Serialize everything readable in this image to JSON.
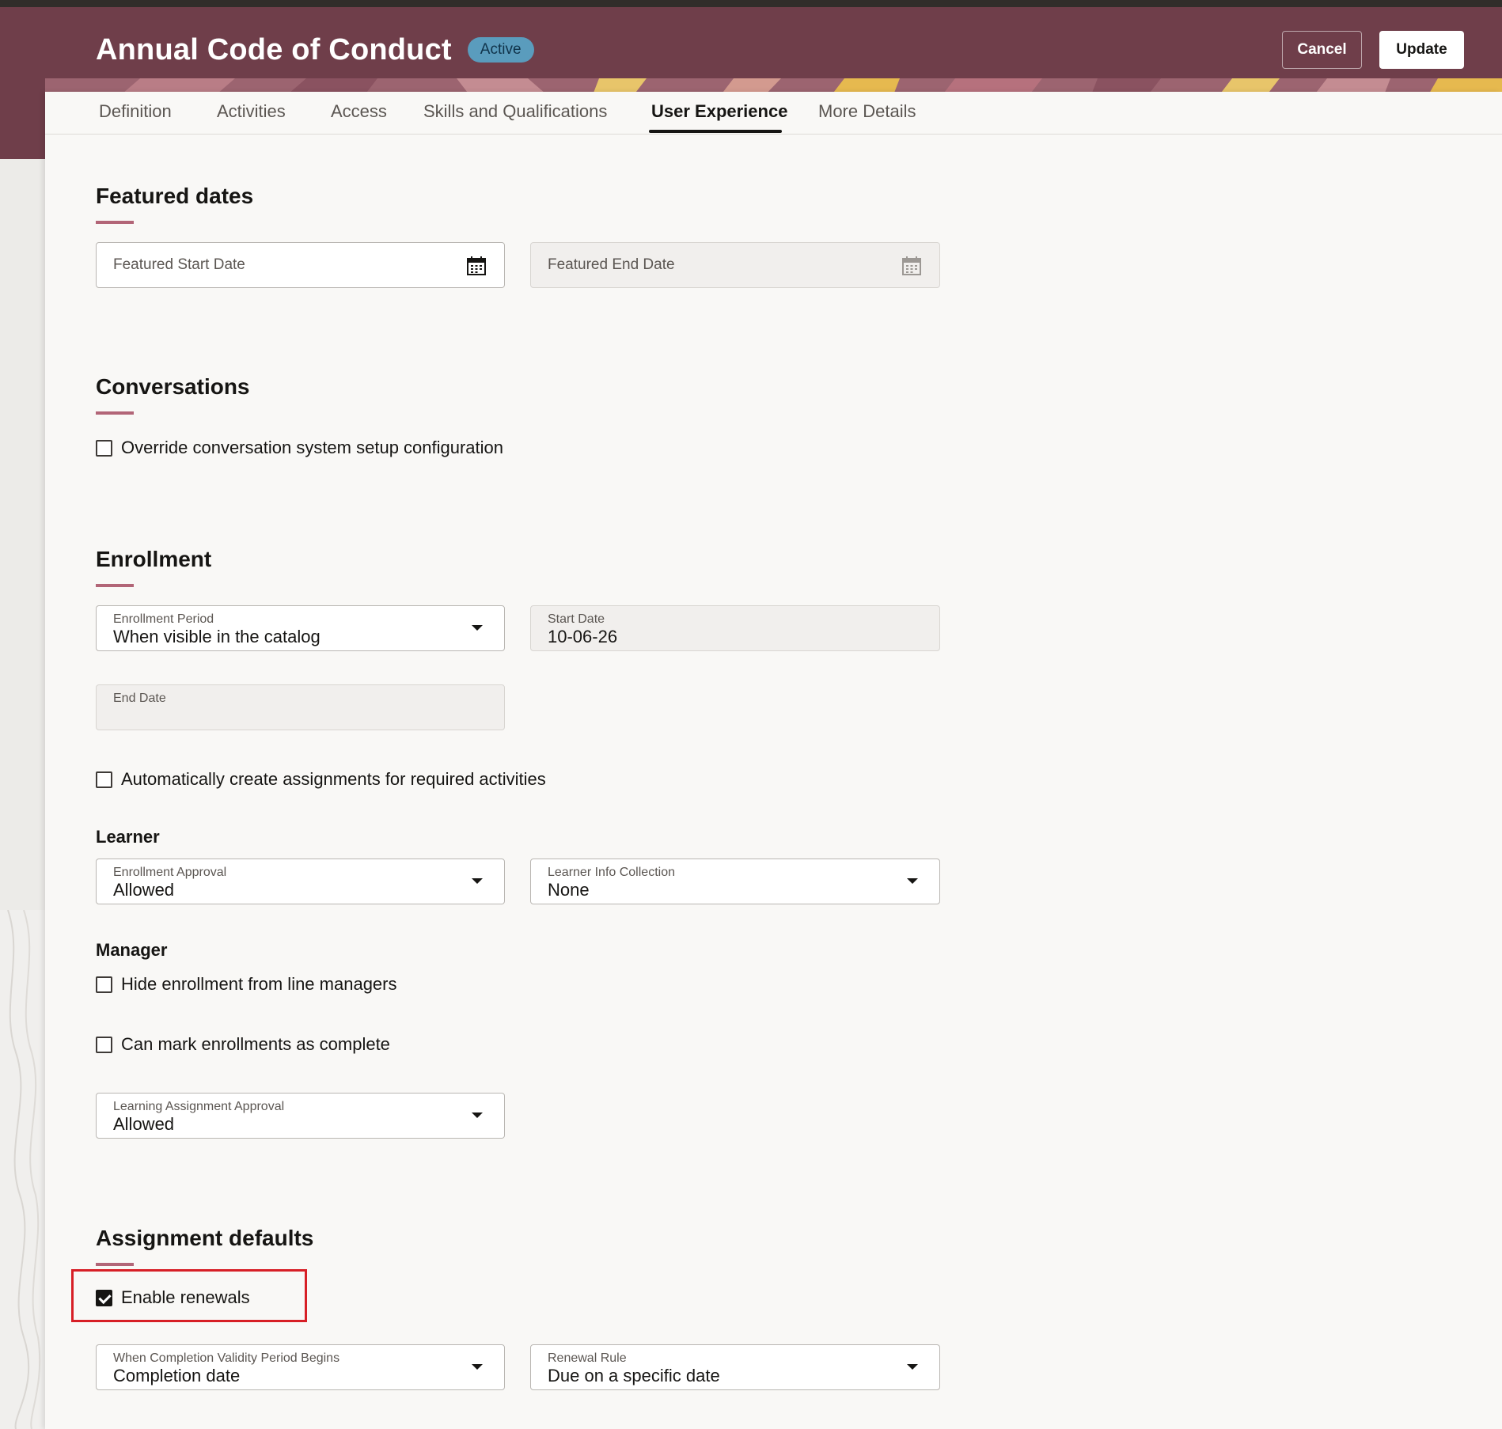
{
  "header": {
    "title": "Annual Code of Conduct",
    "status": "Active",
    "cancel_label": "Cancel",
    "update_label": "Update"
  },
  "tabs": [
    {
      "label": "Definition"
    },
    {
      "label": "Activities"
    },
    {
      "label": "Access"
    },
    {
      "label": "Skills and Qualifications"
    },
    {
      "label": "User Experience",
      "active": true
    },
    {
      "label": "More Details"
    }
  ],
  "featured_dates": {
    "title": "Featured dates",
    "start_placeholder": "Featured Start Date",
    "end_placeholder": "Featured End Date"
  },
  "conversations": {
    "title": "Conversations",
    "override_label": "Override conversation system setup configuration",
    "override_checked": false
  },
  "enrollment": {
    "title": "Enrollment",
    "period_label": "Enrollment Period",
    "period_value": "When visible in the catalog",
    "start_date_label": "Start Date",
    "start_date_value": "10-06-26",
    "end_date_label": "End Date",
    "end_date_value": "",
    "auto_assign_label": "Automatically create assignments for required activities",
    "auto_assign_checked": false,
    "learner": {
      "title": "Learner",
      "approval_label": "Enrollment Approval",
      "approval_value": "Allowed",
      "info_label": "Learner Info Collection",
      "info_value": "None"
    },
    "manager": {
      "title": "Manager",
      "hide_label": "Hide enrollment from line managers",
      "hide_checked": false,
      "mark_complete_label": "Can mark enrollments as complete",
      "mark_complete_checked": false,
      "assignment_approval_label": "Learning Assignment Approval",
      "assignment_approval_value": "Allowed"
    }
  },
  "assignment_defaults": {
    "title": "Assignment defaults",
    "renewals_label": "Enable renewals",
    "renewals_checked": true,
    "validity_label": "When Completion Validity Period Begins",
    "validity_value": "Completion date",
    "rule_label": "Renewal Rule",
    "rule_value": "Due on a specific date"
  },
  "colors": {
    "header_bg": "#6f3e4a",
    "accent_bar": "#b26577",
    "badge_bg": "#5a9cbd",
    "highlight": "#d71f26"
  }
}
